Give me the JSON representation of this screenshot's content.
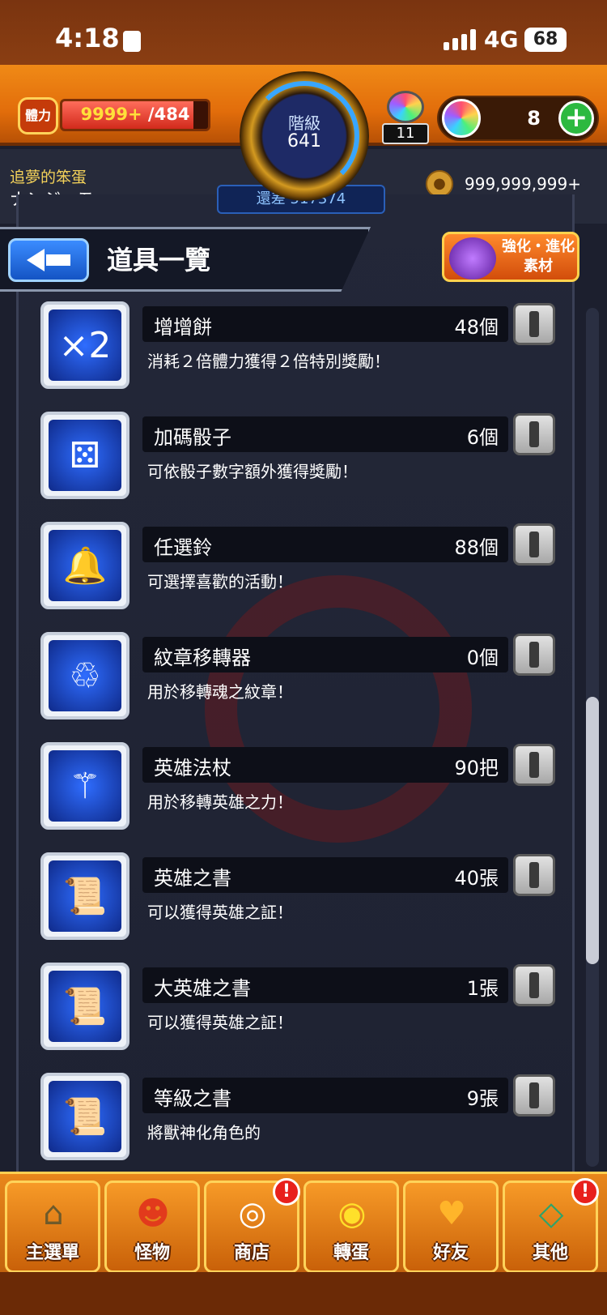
{
  "status_bar": {
    "time": "4:18",
    "network": "4G",
    "battery": "68"
  },
  "hud": {
    "stamina_icon_label": "體力",
    "stamina_current": "9999+",
    "stamina_max": "/484",
    "stamina_fill_fraction": 0.9,
    "rank_label": "階級",
    "rank_value": "641",
    "rank_diff": "還差 517374",
    "orb_bag_count": "11",
    "orb_count": "8",
    "orb_add_label": "+",
    "gold_amount": "999,999,999+"
  },
  "player": {
    "title": "追夢的笨蛋",
    "name": "ナンジャモ"
  },
  "page": {
    "title": "道具一覽",
    "evo_button_label": "強化・進化素材"
  },
  "items": [
    {
      "name": "增增餅",
      "qty": "48個",
      "desc": "消耗２倍體力獲得２倍特別獎勵！",
      "icon": "×2"
    },
    {
      "name": "加碼骰子",
      "qty": "6個",
      "desc": "可依骰子數字額外獲得獎勵！",
      "icon": "⚄"
    },
    {
      "name": "任選鈴",
      "qty": "88個",
      "desc": "可選擇喜歡的活動！",
      "icon": "🔔"
    },
    {
      "name": "紋章移轉器",
      "qty": "0個",
      "desc": "用於移轉魂之紋章！",
      "icon": "♲"
    },
    {
      "name": "英雄法杖",
      "qty": "90把",
      "desc": "用於移轉英雄之力！",
      "icon": "⚚"
    },
    {
      "name": "英雄之書",
      "qty": "40張",
      "desc": "可以獲得英雄之証！",
      "icon": "📜"
    },
    {
      "name": "大英雄之書",
      "qty": "1張",
      "desc": "可以獲得英雄之証！",
      "icon": "📜"
    },
    {
      "name": "等級之書",
      "qty": "9張",
      "desc": "將獸神化角色的",
      "icon": "📜"
    }
  ],
  "nav": [
    {
      "label": "主選單",
      "icon": "⌂",
      "badge": ""
    },
    {
      "label": "怪物",
      "icon": "☻",
      "badge": ""
    },
    {
      "label": "商店",
      "icon": "◎",
      "badge": "!"
    },
    {
      "label": "轉蛋",
      "icon": "◉",
      "badge": ""
    },
    {
      "label": "好友",
      "icon": "♥",
      "badge": ""
    },
    {
      "label": "其他",
      "icon": "◇",
      "badge": "!"
    }
  ],
  "colors": {
    "accent_orange": "#e26d0b",
    "hud_gold": "#ffd35a",
    "badge_red": "#e8201c"
  }
}
